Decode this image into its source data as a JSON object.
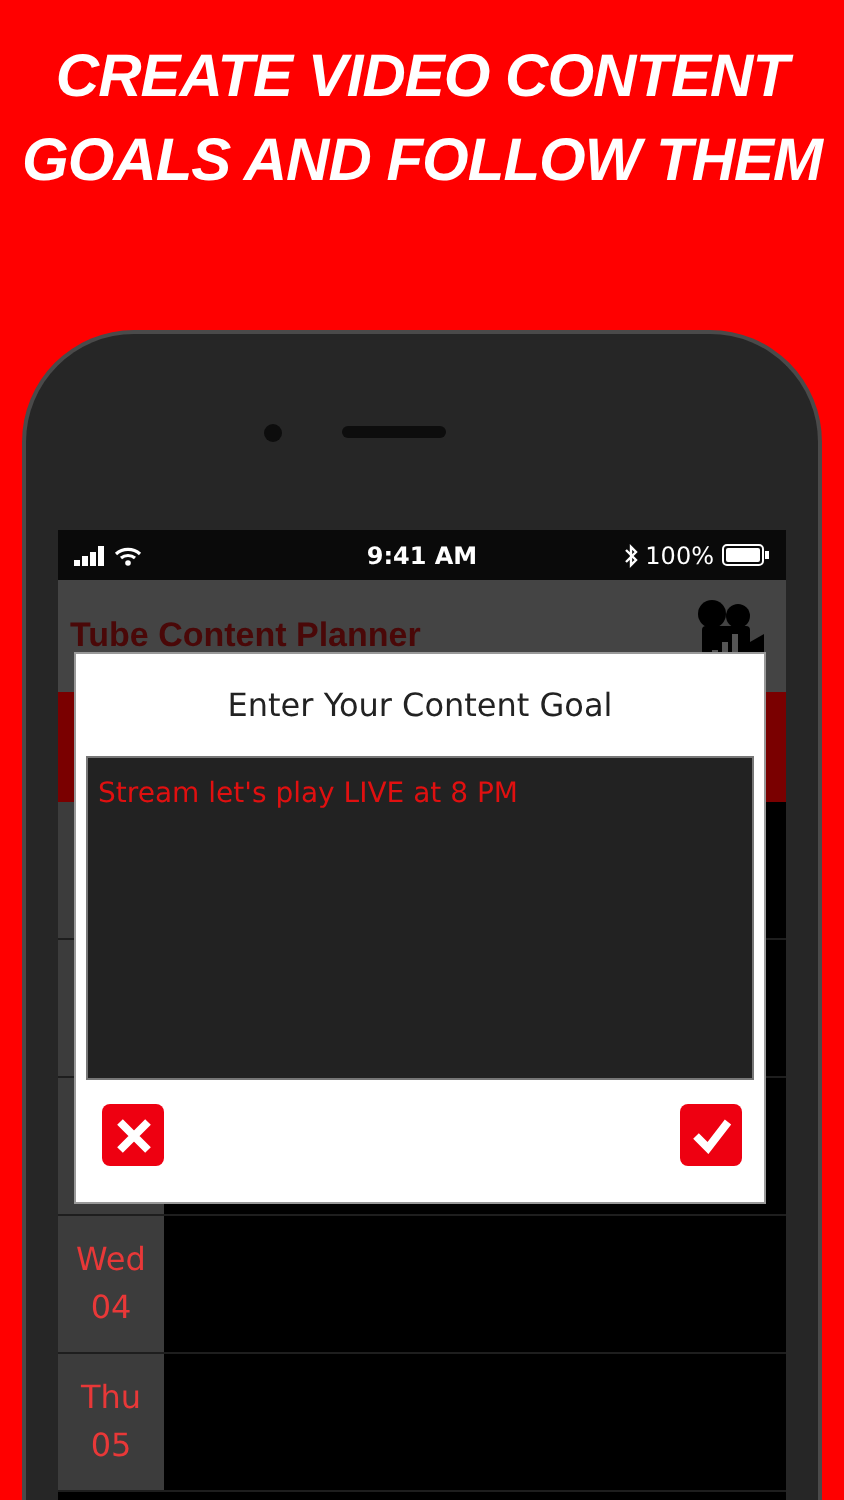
{
  "headline": [
    "CREATE VIDEO CONTENT",
    "GOALS AND FOLLOW THEM"
  ],
  "status_bar": {
    "time": "9:41 AM",
    "battery": "100%"
  },
  "app_header": {
    "title": "Tube Content Planner"
  },
  "days": [
    {
      "weekday": "Wed",
      "date": "04"
    },
    {
      "weekday": "Thu",
      "date": "05"
    }
  ],
  "dialog": {
    "title": "Enter Your Content Goal",
    "value": "Stream let's play LIVE at 8 PM"
  }
}
